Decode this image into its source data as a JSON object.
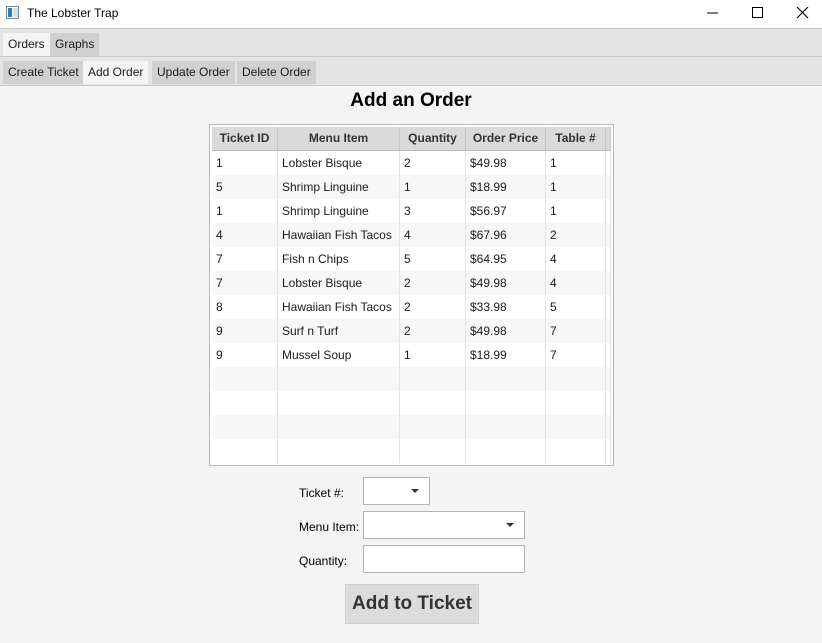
{
  "window": {
    "title": "The Lobster Trap",
    "app_icon": "window-app-icon",
    "controls": [
      "minimize-icon",
      "maximize-icon",
      "close-icon"
    ]
  },
  "main_tabs": [
    {
      "label": "Orders",
      "selected": true
    },
    {
      "label": "Graphs",
      "selected": false
    }
  ],
  "sub_tabs": [
    {
      "label": "Create Ticket",
      "selected": false
    },
    {
      "label": "Add Order",
      "selected": true
    },
    {
      "label": "Update Order",
      "selected": false
    },
    {
      "label": "Delete Order",
      "selected": false
    }
  ],
  "heading": "Add an Order",
  "table": {
    "columns": [
      "Ticket ID",
      "Menu Item",
      "Quantity",
      "Order Price",
      "Table #"
    ],
    "rows": [
      [
        "1",
        "Lobster Bisque",
        "2",
        "$49.98",
        "1"
      ],
      [
        "5",
        "Shrimp Linguine",
        "1",
        "$18.99",
        "1"
      ],
      [
        "1",
        "Shrimp Linguine",
        "3",
        "$56.97",
        "1"
      ],
      [
        "4",
        "Hawaiian Fish Tacos",
        "4",
        "$67.96",
        "2"
      ],
      [
        "7",
        "Fish n Chips",
        "5",
        "$64.95",
        "4"
      ],
      [
        "7",
        "Lobster Bisque",
        "2",
        "$49.98",
        "4"
      ],
      [
        "8",
        "Hawaiian Fish Tacos",
        "2",
        "$33.98",
        "5"
      ],
      [
        "9",
        "Surf n Turf",
        "2",
        "$49.98",
        "7"
      ],
      [
        "9",
        "Mussel Soup",
        "1",
        "$18.99",
        "7"
      ]
    ]
  },
  "form": {
    "ticket_label": "Ticket #:",
    "ticket_value": "",
    "menu_item_label": "Menu Item:",
    "menu_item_value": "",
    "quantity_label": "Quantity:",
    "quantity_value": "",
    "submit_label": "Add to Ticket"
  }
}
